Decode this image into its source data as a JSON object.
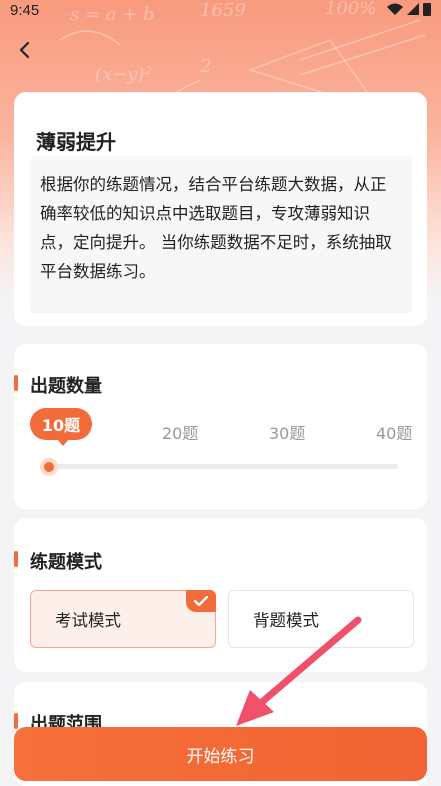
{
  "status_bar": {
    "time": "9:45"
  },
  "header": {
    "back_icon": "chevron-left-icon"
  },
  "intro": {
    "title": "薄弱提升",
    "description": "根据你的练题情况，结合平台练题大数据，从正确率较低的知识点中选取题目，专攻薄弱知识点，定向提升。 当你练题数据不足时，系统抽取平台数据练习。"
  },
  "question_count": {
    "title": "出题数量",
    "options": [
      "10题",
      "20题",
      "30题",
      "40题"
    ],
    "selected": "10题",
    "slider_fraction": 0
  },
  "practice_mode": {
    "title": "练题模式",
    "exam_label": "考试模式",
    "recite_label": "背题模式",
    "selected": "考试模式"
  },
  "question_range": {
    "title": "出题范围"
  },
  "footer": {
    "start_label": "开始练习"
  },
  "colors": {
    "accent": "#f26b3a",
    "hero": "#f89a7e"
  }
}
